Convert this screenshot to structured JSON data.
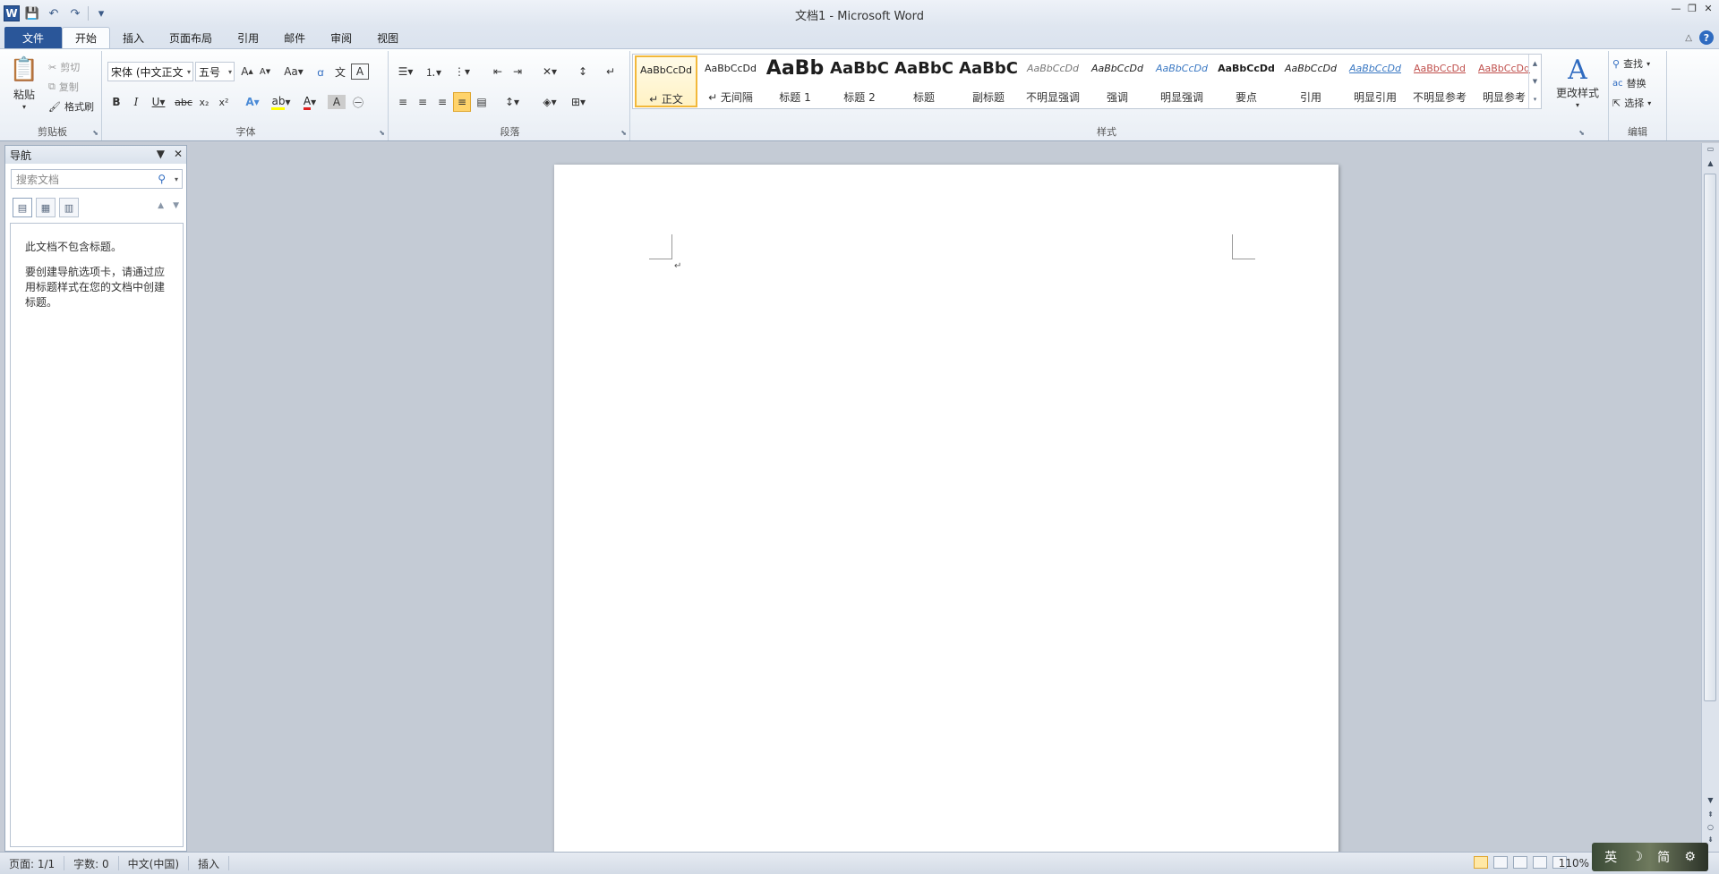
{
  "title_bar": {
    "title": "文档1 - Microsoft Word",
    "logo_letter": "W"
  },
  "tabs": [
    {
      "label": "文件"
    },
    {
      "label": "开始"
    },
    {
      "label": "插入"
    },
    {
      "label": "页面布局"
    },
    {
      "label": "引用"
    },
    {
      "label": "邮件"
    },
    {
      "label": "审阅"
    },
    {
      "label": "视图"
    }
  ],
  "ribbon": {
    "clipboard": {
      "paste": "粘贴",
      "cut": "剪切",
      "copy": "复制",
      "format_painter": "格式刷",
      "group": "剪贴板"
    },
    "font": {
      "font_name": "宋体 (中文正文",
      "font_size": "五号",
      "group": "字体"
    },
    "paragraph": {
      "group": "段落"
    },
    "styles": {
      "group": "样式",
      "items": [
        {
          "preview": "AaBbCcDd",
          "name": "↵ 正文"
        },
        {
          "preview": "AaBbCcDd",
          "name": "↵ 无间隔"
        },
        {
          "preview": "AaBb",
          "name": "标题 1"
        },
        {
          "preview": "AaBbC",
          "name": "标题 2"
        },
        {
          "preview": "AaBbC",
          "name": "标题"
        },
        {
          "preview": "AaBbC",
          "name": "副标题"
        },
        {
          "preview": "AaBbCcDd",
          "name": "不明显强调"
        },
        {
          "preview": "AaBbCcDd",
          "name": "强调"
        },
        {
          "preview": "AaBbCcDd",
          "name": "明显强调"
        },
        {
          "preview": "AaBbCcDd",
          "name": "要点"
        },
        {
          "preview": "AaBbCcDd",
          "name": "引用"
        },
        {
          "preview": "AaBbCcDd",
          "name": "明显引用"
        },
        {
          "preview": "AaBbCcDd",
          "name": "不明显参考"
        },
        {
          "preview": "AaBbCcDd",
          "name": "明显参考"
        }
      ],
      "change_styles": "更改样式"
    },
    "editing": {
      "find": "查找",
      "replace": "替换",
      "select": "选择",
      "group": "编辑"
    }
  },
  "nav_pane": {
    "title": "导航",
    "search_placeholder": "搜索文档",
    "msg1": "此文档不包含标题。",
    "msg2": "要创建导航选项卡，请通过应用标题样式在您的文档中创建标题。"
  },
  "status_bar": {
    "page": "页面: 1/1",
    "words": "字数: 0",
    "language": "中文(中国)",
    "mode": "插入",
    "zoom": "110%"
  },
  "ime": {
    "lang": "英",
    "mode": "简"
  },
  "colors": {
    "file_tab": "#2a5699",
    "accent_blue": "#2f6bc0",
    "selected_style": "#f2b83a"
  }
}
